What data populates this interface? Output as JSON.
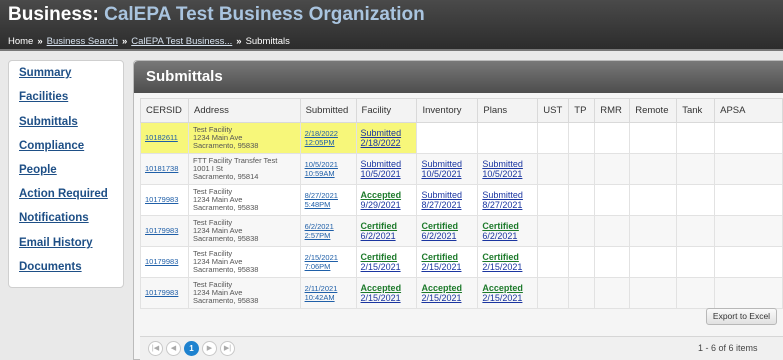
{
  "header": {
    "title_prefix": "Business:",
    "org_name": "CalEPA Test Business Organization",
    "breadcrumb": {
      "home": "Home",
      "sep": "»",
      "search": "Business Search",
      "business": "CalEPA Test Business...",
      "current": "Submittals"
    }
  },
  "sidebar": {
    "items": [
      {
        "label": "Summary"
      },
      {
        "label": "Facilities"
      },
      {
        "label": "Submittals"
      },
      {
        "label": "Compliance"
      },
      {
        "label": "People"
      },
      {
        "label": "Action Required"
      },
      {
        "label": "Notifications"
      },
      {
        "label": "Email History"
      },
      {
        "label": "Documents"
      }
    ]
  },
  "panel": {
    "title": "Submittals"
  },
  "table": {
    "headers": [
      "CERSID",
      "Address",
      "Submitted",
      "Facility",
      "Inventory",
      "Plans",
      "UST",
      "TP",
      "RMR",
      "Remote",
      "Tank",
      "APSA"
    ],
    "rows": [
      {
        "cersid": "10182611",
        "addr1": "Test Facility",
        "addr2": "1234 Main Ave",
        "addr3": "Sacramento, 95838",
        "sub_date": "2/18/2022",
        "sub_time": "12:05PM",
        "facility_status": "Submitted",
        "facility_date": "2/18/2022",
        "inventory_status": "",
        "inventory_date": "",
        "plans_status": "",
        "plans_date": ""
      },
      {
        "cersid": "10181738",
        "addr1": "FTT Facility Transfer Test",
        "addr2": "1001 I St",
        "addr3": "Sacramento, 95814",
        "sub_date": "10/5/2021",
        "sub_time": "10:59AM",
        "facility_status": "Submitted",
        "facility_date": "10/5/2021",
        "inventory_status": "Submitted",
        "inventory_date": "10/5/2021",
        "plans_status": "Submitted",
        "plans_date": "10/5/2021"
      },
      {
        "cersid": "10179983",
        "addr1": "Test Facility",
        "addr2": "1234 Main Ave",
        "addr3": "Sacramento, 95838",
        "sub_date": "8/27/2021",
        "sub_time": "5:48PM",
        "facility_status": "Accepted",
        "facility_date": "9/29/2021",
        "inventory_status": "Submitted",
        "inventory_date": "8/27/2021",
        "plans_status": "Submitted",
        "plans_date": "8/27/2021"
      },
      {
        "cersid": "10179983",
        "addr1": "Test Facility",
        "addr2": "1234 Main Ave",
        "addr3": "Sacramento, 95838",
        "sub_date": "6/2/2021",
        "sub_time": "2:57PM",
        "facility_status": "Certified",
        "facility_date": "6/2/2021",
        "inventory_status": "Certified",
        "inventory_date": "6/2/2021",
        "plans_status": "Certified",
        "plans_date": "6/2/2021"
      },
      {
        "cersid": "10179983",
        "addr1": "Test Facility",
        "addr2": "1234 Main Ave",
        "addr3": "Sacramento, 95838",
        "sub_date": "2/15/2021",
        "sub_time": "7:06PM",
        "facility_status": "Certified",
        "facility_date": "2/15/2021",
        "inventory_status": "Certified",
        "inventory_date": "2/15/2021",
        "plans_status": "Certified",
        "plans_date": "2/15/2021"
      },
      {
        "cersid": "10179983",
        "addr1": "Test Facility",
        "addr2": "1234 Main Ave",
        "addr3": "Sacramento, 95838",
        "sub_date": "2/11/2021",
        "sub_time": "10:42AM",
        "facility_status": "Accepted",
        "facility_date": "2/15/2021",
        "inventory_status": "Accepted",
        "inventory_date": "2/15/2021",
        "plans_status": "Accepted",
        "plans_date": "2/15/2021"
      }
    ]
  },
  "footer": {
    "export_label": "Export to Excel",
    "page_current": "1",
    "items_text": "1 - 6 of 6 items",
    "pager_icons": [
      "first-page-icon",
      "prev-page-icon",
      "next-page-icon",
      "last-page-icon"
    ]
  },
  "colors": {
    "header_bg": "#3a3a3a",
    "org_name": "#a9c4df",
    "nav_link": "#1e4f86",
    "highlight": "#f7f77a",
    "submitted": "#1a35a0",
    "accepted_certified": "#1d7a2b",
    "pager_current": "#1e82cf"
  }
}
